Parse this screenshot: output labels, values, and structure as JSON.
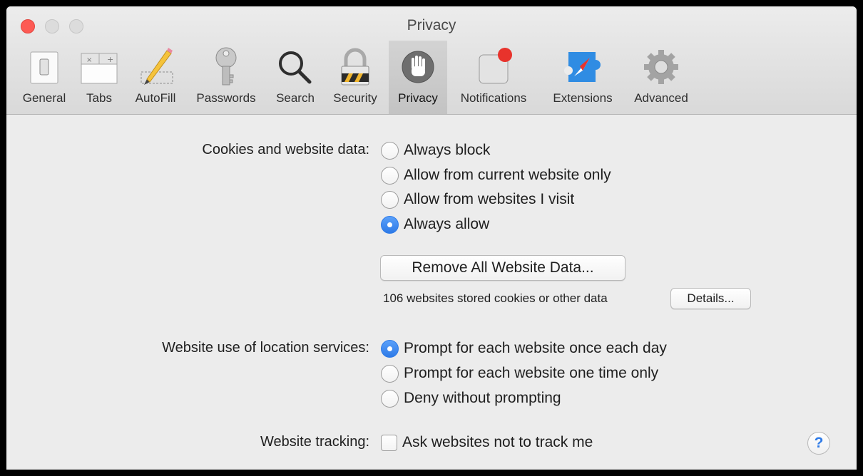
{
  "window": {
    "title": "Privacy"
  },
  "toolbar": {
    "items": [
      {
        "label": "General",
        "icon": "general-switch-icon"
      },
      {
        "label": "Tabs",
        "icon": "tabs-icon"
      },
      {
        "label": "AutoFill",
        "icon": "pencil-icon"
      },
      {
        "label": "Passwords",
        "icon": "key-icon"
      },
      {
        "label": "Search",
        "icon": "magnifier-icon"
      },
      {
        "label": "Security",
        "icon": "padlock-icon"
      },
      {
        "label": "Privacy",
        "icon": "hand-icon",
        "selected": true
      },
      {
        "label": "Notifications",
        "icon": "notification-badge-icon"
      },
      {
        "label": "Extensions",
        "icon": "puzzle-compass-icon"
      },
      {
        "label": "Advanced",
        "icon": "gear-icon"
      }
    ]
  },
  "cookies": {
    "label": "Cookies and website data:",
    "options": [
      "Always block",
      "Allow from current website only",
      "Allow from websites I visit",
      "Always allow"
    ],
    "selected": "Always allow",
    "remove_button": "Remove All Website Data...",
    "stored_text": "106 websites stored cookies or other data",
    "details_button": "Details..."
  },
  "location": {
    "label": "Website use of location services:",
    "options": [
      "Prompt for each website once each day",
      "Prompt for each website one time only",
      "Deny without prompting"
    ],
    "selected": "Prompt for each website once each day"
  },
  "tracking": {
    "label": "Website tracking:",
    "checkbox_label": "Ask websites not to track me",
    "checked": false
  },
  "help": {
    "symbol": "?"
  },
  "colors": {
    "accent": "#2f7be7",
    "close": "#fd5a54",
    "badge": "#e8332c"
  }
}
